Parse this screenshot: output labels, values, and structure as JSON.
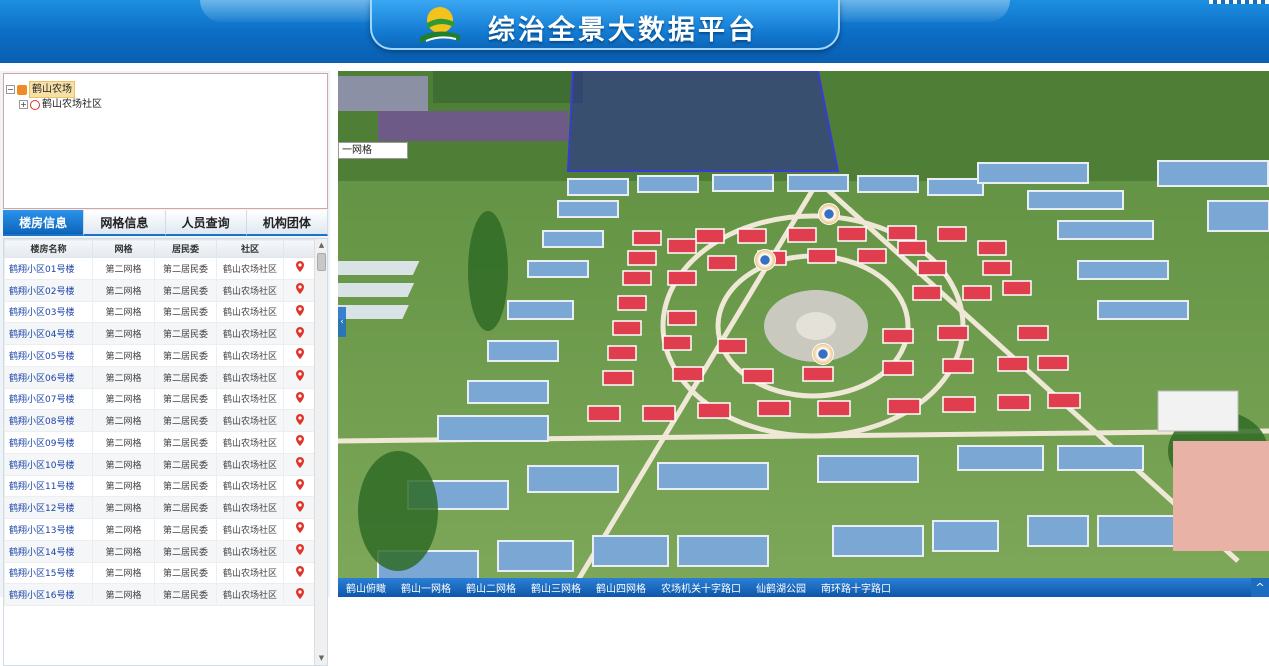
{
  "header": {
    "title": "综治全景大数据平台",
    "colors": {
      "bar": "#0b6cc4",
      "plate": "#1279d0"
    }
  },
  "tree": {
    "root_label": "鹤山农场",
    "child_label": "鹤山农场社区",
    "expand_symbol": "+",
    "collapse_symbol": "−"
  },
  "tabs": [
    {
      "label": "楼房信息",
      "active": true
    },
    {
      "label": "网格信息",
      "active": false
    },
    {
      "label": "人员查询",
      "active": false
    },
    {
      "label": "机构团体",
      "active": false
    }
  ],
  "table": {
    "columns": [
      "楼房名称",
      "网格",
      "居民委",
      "社区"
    ],
    "rows": [
      {
        "name": "鹤翔小区01号楼",
        "grid": "第二网格",
        "committee": "第二居民委",
        "community": "鹤山农场社区"
      },
      {
        "name": "鹤翔小区02号楼",
        "grid": "第二网格",
        "committee": "第二居民委",
        "community": "鹤山农场社区"
      },
      {
        "name": "鹤翔小区03号楼",
        "grid": "第二网格",
        "committee": "第二居民委",
        "community": "鹤山农场社区"
      },
      {
        "name": "鹤翔小区04号楼",
        "grid": "第二网格",
        "committee": "第二居民委",
        "community": "鹤山农场社区"
      },
      {
        "name": "鹤翔小区05号楼",
        "grid": "第二网格",
        "committee": "第二居民委",
        "community": "鹤山农场社区"
      },
      {
        "name": "鹤翔小区06号楼",
        "grid": "第二网格",
        "committee": "第二居民委",
        "community": "鹤山农场社区"
      },
      {
        "name": "鹤翔小区07号楼",
        "grid": "第二网格",
        "committee": "第二居民委",
        "community": "鹤山农场社区"
      },
      {
        "name": "鹤翔小区08号楼",
        "grid": "第二网格",
        "committee": "第二居民委",
        "community": "鹤山农场社区"
      },
      {
        "name": "鹤翔小区09号楼",
        "grid": "第二网格",
        "committee": "第二居民委",
        "community": "鹤山农场社区"
      },
      {
        "name": "鹤翔小区10号楼",
        "grid": "第二网格",
        "committee": "第二居民委",
        "community": "鹤山农场社区"
      },
      {
        "name": "鹤翔小区11号楼",
        "grid": "第二网格",
        "committee": "第二居民委",
        "community": "鹤山农场社区"
      },
      {
        "name": "鹤翔小区12号楼",
        "grid": "第二网格",
        "committee": "第二居民委",
        "community": "鹤山农场社区"
      },
      {
        "name": "鹤翔小区13号楼",
        "grid": "第二网格",
        "committee": "第二居民委",
        "community": "鹤山农场社区"
      },
      {
        "name": "鹤翔小区14号楼",
        "grid": "第二网格",
        "committee": "第二居民委",
        "community": "鹤山农场社区"
      },
      {
        "name": "鹤翔小区15号楼",
        "grid": "第二网格",
        "committee": "第二居民委",
        "community": "鹤山农场社区"
      },
      {
        "name": "鹤翔小区16号楼",
        "grid": "第二网格",
        "committee": "第二居民委",
        "community": "鹤山农场社区"
      }
    ],
    "pin_color": "#e0342a",
    "name_color": "#1c44a8"
  },
  "map": {
    "grid_label": "一网格",
    "side_arrow": "‹",
    "bottom_links": [
      "鹤山俯瞰",
      "鹤山一网格",
      "鹤山二网格",
      "鹤山三网格",
      "鹤山四网格",
      "农场机关十字路口",
      "仙鹤湖公园",
      "南环路十字路口"
    ],
    "toggle": "^"
  }
}
